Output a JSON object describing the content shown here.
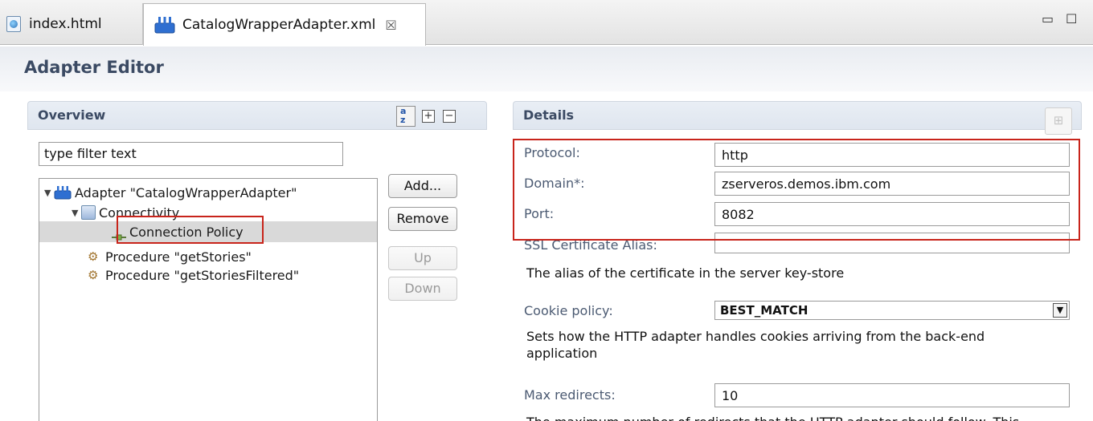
{
  "tabs": [
    {
      "label": "index.html",
      "icon": "html-page-icon"
    },
    {
      "label": "CatalogWrapperAdapter.xml",
      "icon": "adapter-icon",
      "close": "☒"
    }
  ],
  "window_controls": {
    "minimize": "▭",
    "maximize": "☐"
  },
  "editor": {
    "title": "Adapter Editor"
  },
  "overview": {
    "title": "Overview",
    "filter_text": "type filter text",
    "tree": [
      {
        "label": "Adapter \"CatalogWrapperAdapter\"",
        "icon": "adapter-icon",
        "expanded": true
      },
      {
        "label": "Connectivity",
        "icon": "connectivity-icon",
        "expanded": true
      },
      {
        "label": "Connection Policy",
        "icon": "connection-policy-icon",
        "selected": true
      },
      {
        "label": "Procedure \"getStories\"",
        "icon": "gear-icon"
      },
      {
        "label": "Procedure \"getStoriesFiltered\"",
        "icon": "gear-icon"
      }
    ],
    "buttons": {
      "add": "Add...",
      "remove": "Remove",
      "up": "Up",
      "down": "Down"
    }
  },
  "details": {
    "title": "Details",
    "fields": {
      "protocol": {
        "label": "Protocol:",
        "value": "http"
      },
      "domain": {
        "label": "Domain*:",
        "value": "zserveros.demos.ibm.com"
      },
      "port": {
        "label": "Port:",
        "value": "8082"
      },
      "ssl_alias": {
        "label": "SSL Certificate Alias:",
        "value": ""
      },
      "ssl_desc": "The alias of the certificate in the server key-store",
      "cookie_policy": {
        "label": "Cookie policy:",
        "value": "BEST_MATCH"
      },
      "cookie_desc_1": "Sets how the HTTP adapter handles cookies arriving from the back-end",
      "cookie_desc_2": "application",
      "max_redirects": {
        "label": "Max redirects:",
        "value": "10"
      },
      "redirects_desc": "The maximum number of redirects that the HTTP adapter should follow. This"
    }
  },
  "colors": {
    "highlight": "#c8241b",
    "header_text": "#3b4a63"
  }
}
